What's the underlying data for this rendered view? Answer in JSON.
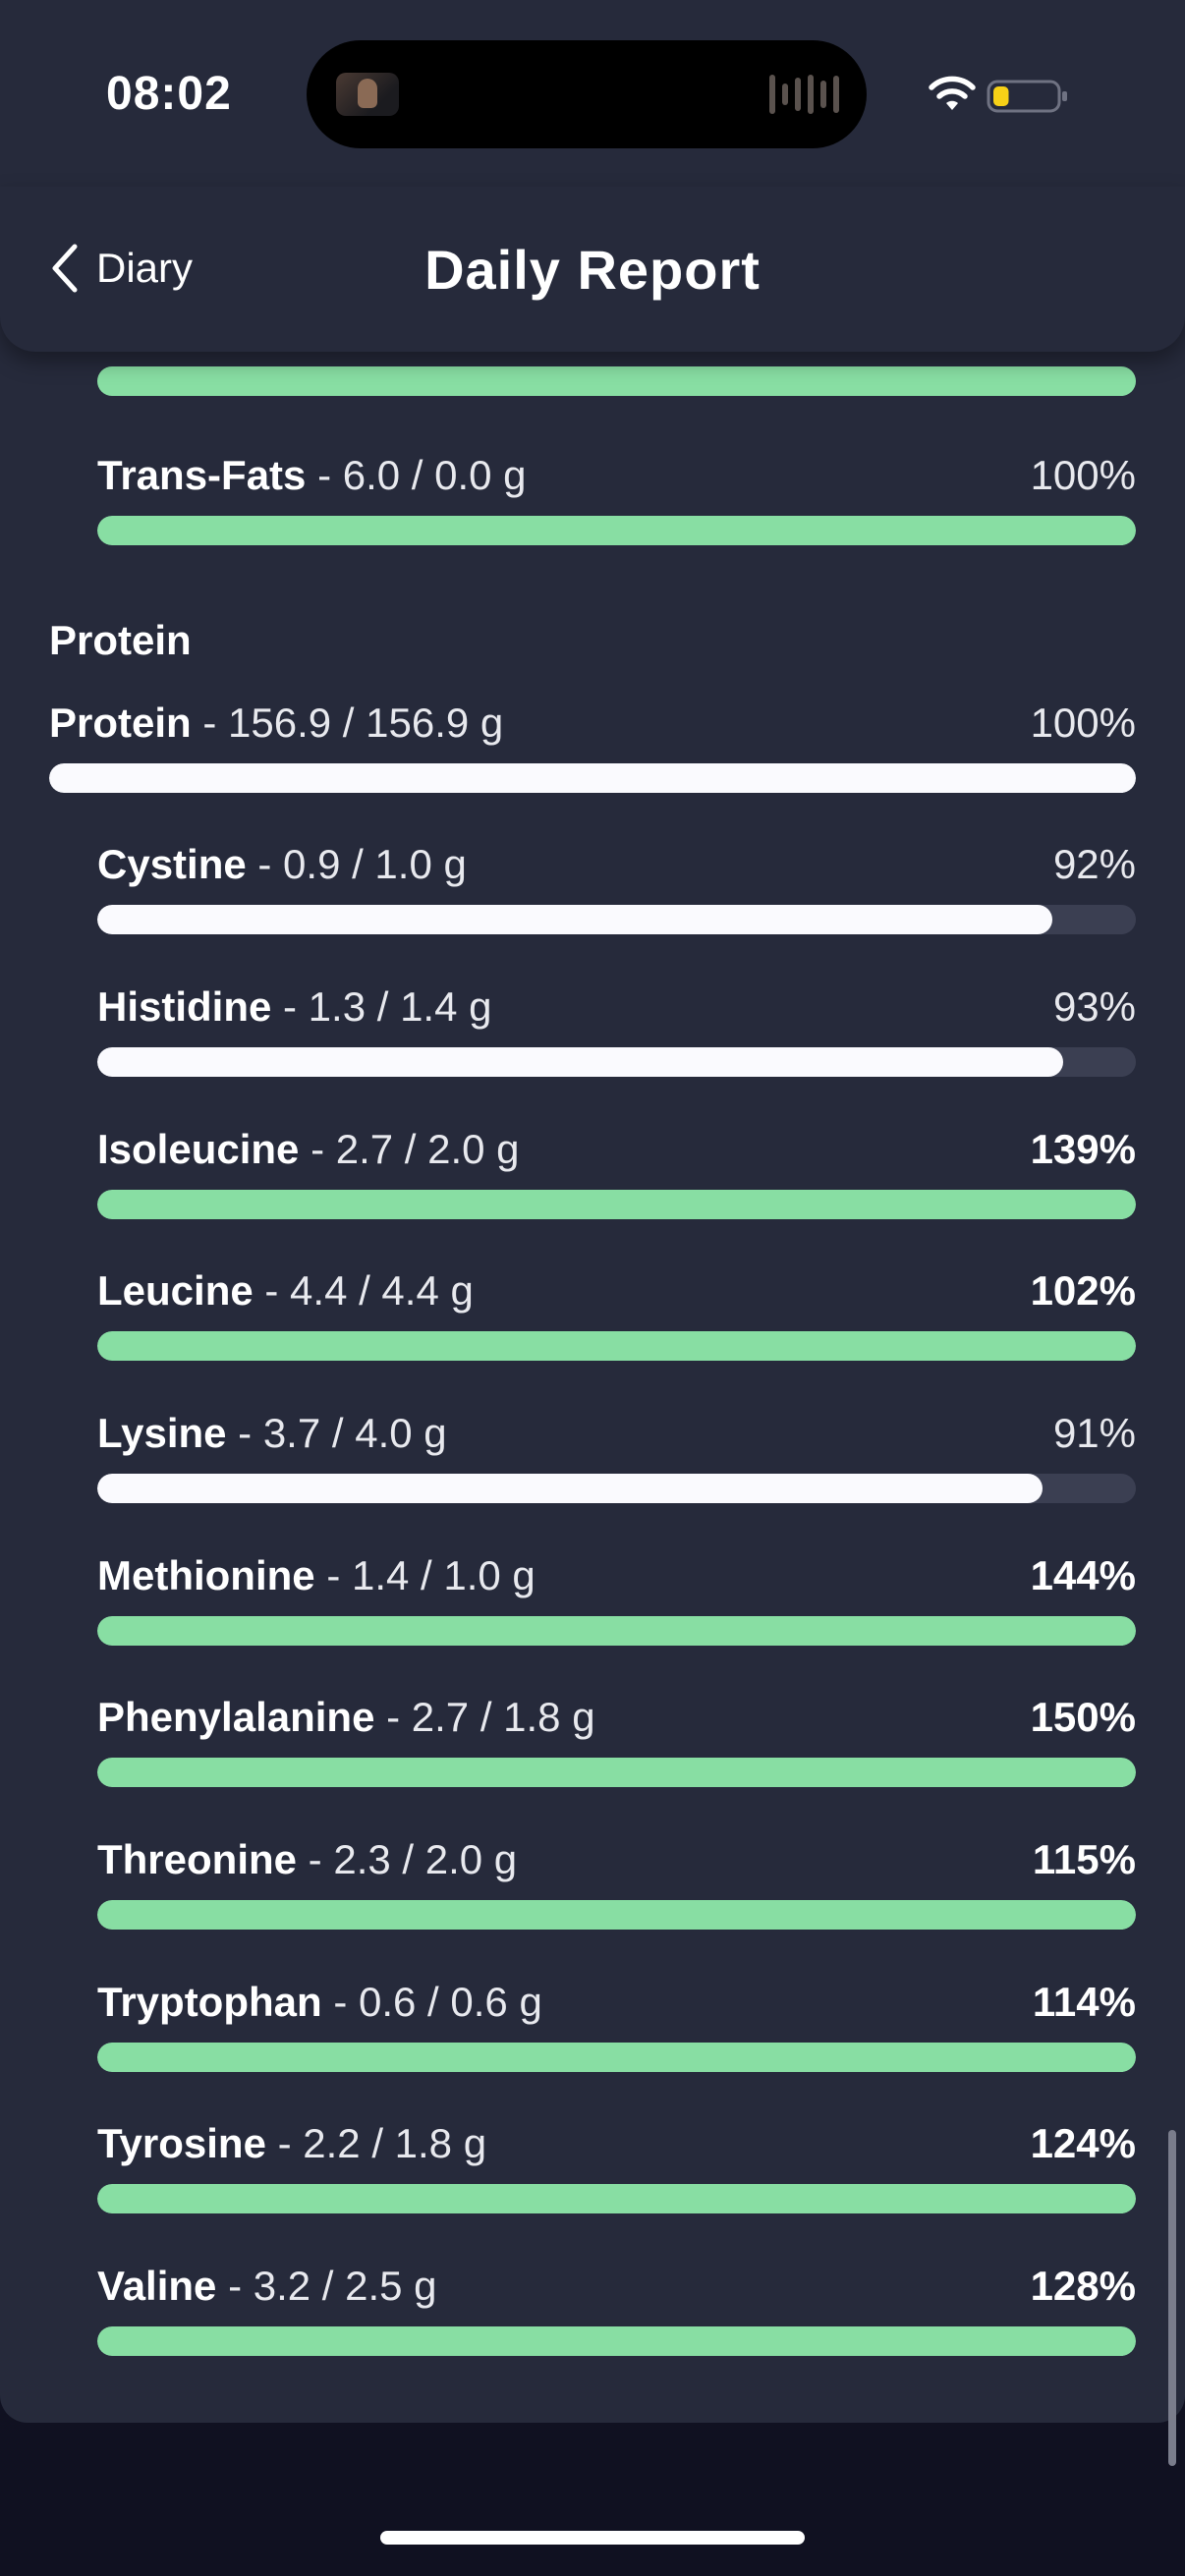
{
  "status_bar": {
    "time": "08:02",
    "icons": [
      "wifi-icon",
      "battery-icon"
    ],
    "battery_level": 0.25
  },
  "header": {
    "back_label": "Diary",
    "back_icon": "chevron-left-icon",
    "title": "Daily Report"
  },
  "colors": {
    "met_bar": "#88dea3",
    "unmet_bar": "#fafafe",
    "track": "#3b3f52",
    "background": "#262a3b"
  },
  "fats": {
    "items": [
      {
        "name": "Trans-Fats",
        "values": " - 6.0 / 0.0 g",
        "percent": "100%",
        "fraction": 1.0,
        "met": true,
        "strong": false
      }
    ]
  },
  "protein": {
    "section_title": "Protein",
    "total": {
      "name": "Protein",
      "values": " - 156.9 / 156.9 g",
      "percent": "100%",
      "fraction": 1.0,
      "met": false,
      "strong": false
    },
    "items": [
      {
        "name": "Cystine",
        "values": " - 0.9 / 1.0 g",
        "percent": "92%",
        "fraction": 0.92,
        "met": false,
        "strong": false
      },
      {
        "name": "Histidine",
        "values": " - 1.3 / 1.4 g",
        "percent": "93%",
        "fraction": 0.93,
        "met": false,
        "strong": false
      },
      {
        "name": "Isoleucine",
        "values": " - 2.7 / 2.0 g",
        "percent": "139%",
        "fraction": 1.0,
        "met": true,
        "strong": true
      },
      {
        "name": "Leucine",
        "values": " - 4.4 / 4.4 g",
        "percent": "102%",
        "fraction": 1.0,
        "met": true,
        "strong": true
      },
      {
        "name": "Lysine",
        "values": " - 3.7 / 4.0 g",
        "percent": "91%",
        "fraction": 0.91,
        "met": false,
        "strong": false
      },
      {
        "name": "Methionine",
        "values": " - 1.4 / 1.0 g",
        "percent": "144%",
        "fraction": 1.0,
        "met": true,
        "strong": true
      },
      {
        "name": "Phenylalanine",
        "values": " - 2.7 / 1.8 g",
        "percent": "150%",
        "fraction": 1.0,
        "met": true,
        "strong": true
      },
      {
        "name": "Threonine",
        "values": " - 2.3 / 2.0 g",
        "percent": "115%",
        "fraction": 1.0,
        "met": true,
        "strong": true
      },
      {
        "name": "Tryptophan",
        "values": " - 0.6 / 0.6 g",
        "percent": "114%",
        "fraction": 1.0,
        "met": true,
        "strong": true
      },
      {
        "name": "Tyrosine",
        "values": " - 2.2 / 1.8 g",
        "percent": "124%",
        "fraction": 1.0,
        "met": true,
        "strong": true
      },
      {
        "name": "Valine",
        "values": " - 3.2 / 2.5 g",
        "percent": "128%",
        "fraction": 1.0,
        "met": true,
        "strong": true
      }
    ]
  }
}
